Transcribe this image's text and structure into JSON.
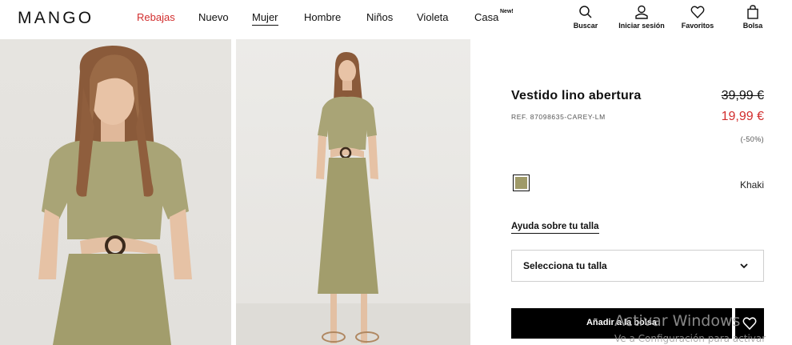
{
  "brand": {
    "logo": "MANGO"
  },
  "nav": {
    "items": [
      "Rebajas",
      "Nuevo",
      "Mujer",
      "Hombre",
      "Niños",
      "Violeta",
      "Casa"
    ],
    "new_badge": "New!"
  },
  "tools": {
    "search": "Buscar",
    "login": "Iniciar sesión",
    "favorites": "Favoritos",
    "bag": "Bolsa"
  },
  "product": {
    "title": "Vestido lino abertura",
    "ref": "REF. 87098635-CAREY-LM",
    "price_old": "39,99 €",
    "price_new": "19,99 €",
    "discount": "(-50%)",
    "color_name": "Khaki",
    "color_hex": "#9f9a68",
    "size_help": "Ayuda sobre tu talla",
    "size_select": "Selecciona tu talla",
    "add_to_bag": "Añadir a la bolsa"
  },
  "colors": {
    "sale": "#d22e2e",
    "dress": "#a9a476",
    "photo_bg": "#e5e3df"
  },
  "watermark": {
    "line1": "Activar Windows",
    "line2": "Ve a Configuración para activar"
  }
}
